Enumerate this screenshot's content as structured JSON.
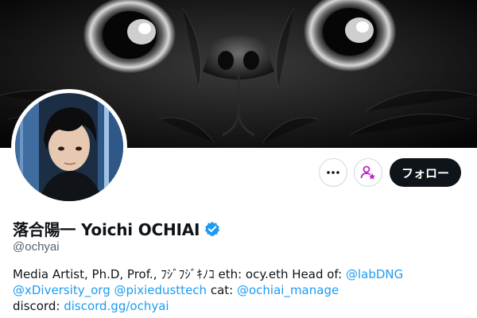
{
  "profile": {
    "display_name": "落合陽一 Yoichi OCHIAI",
    "handle": "@ochyai",
    "verified": true
  },
  "actions": {
    "more_icon": "more-dots-icon",
    "subscribe_icon": "person-star-icon",
    "follow_label": "フォロー"
  },
  "bio": {
    "line1": {
      "t1": "Media Artist, Ph.D, Prof., ﾌｼﾞﾌｼﾞｷﾉｺ eth: ocy.eth Head of: ",
      "l1": "@labDNG"
    },
    "line2": {
      "l1": "@xDiversity_org",
      "sep": " ",
      "l2": "@pixiedusttech",
      "t1": " cat: ",
      "l3": "@ochiai_manage"
    },
    "line3": {
      "t1": "discord: ",
      "l1": "discord.gg/ochyai"
    }
  },
  "colors": {
    "link": "#1d9bf0",
    "text": "#0f1419",
    "muted": "#536471",
    "follow_bg": "#0f1419",
    "subscribe_accent": "#c01ec9",
    "verified": "#1d9bf0"
  }
}
